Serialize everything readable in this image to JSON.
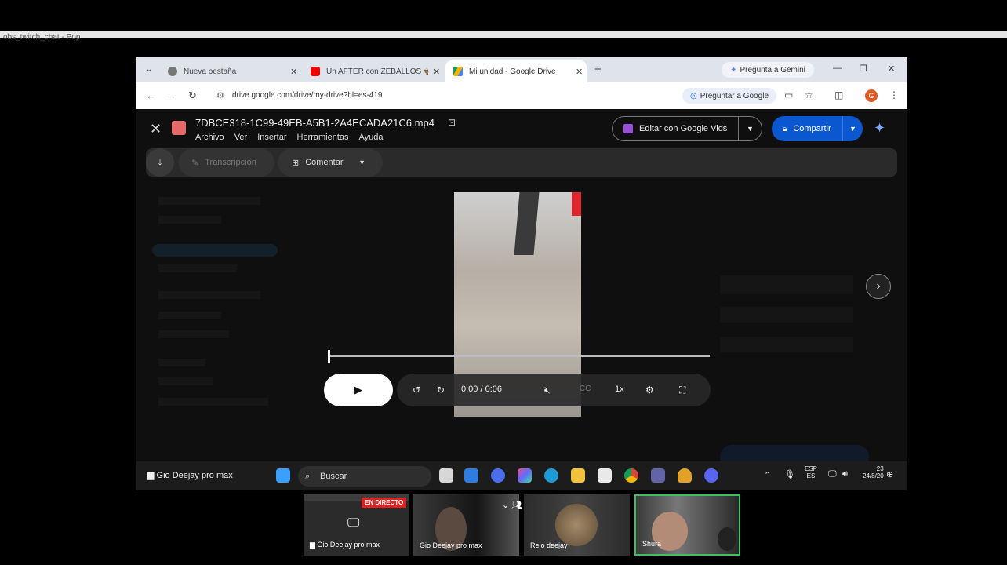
{
  "screen": {
    "top_strip_text": "obs_twitch_chat - Pop"
  },
  "browser": {
    "tabs": [
      {
        "label": "Nueva pestaña",
        "icon": "chrome-icon",
        "close": "✕"
      },
      {
        "label": "Un AFTER con ZEBALLOS 🦋 | L",
        "icon": "youtube-icon",
        "close": "✕"
      },
      {
        "label": "Mi unidad - Google Drive",
        "icon": "drive-icon",
        "close": "✕"
      }
    ],
    "new_tab": "+",
    "gemini_button": "Pregunta a Gemini",
    "url": "drive.google.com/drive/my-drive?hl=es-419",
    "ask_google": "Preguntar a Google",
    "profile_initial": "G"
  },
  "viewer": {
    "file_title": "7DBCE318-1C99-49EB-A5B1-2A4ECADA21C6.mp4",
    "menu": [
      "Archivo",
      "Ver",
      "Insertar",
      "Herramientas",
      "Ayuda"
    ],
    "edit_vids_label": "Editar con Google Vids",
    "share_label": "Compartir",
    "transcription_label": "Transcripción",
    "comment_label": "Comentar",
    "player": {
      "time": "0:00 / 0:06",
      "speed": "1x",
      "progress_fraction": 0.0
    }
  },
  "taskbar": {
    "window_label": "Gio Deejay pro max",
    "search_label": "Buscar",
    "lang_top": "ESP",
    "lang_bottom": "ES",
    "time": "23",
    "date": "24/8/20"
  },
  "cams": [
    {
      "name": "Gio Deejay pro max",
      "live_badge": "EN DIRECTO"
    },
    {
      "name": "Gio Deejay pro max"
    },
    {
      "name": "Relo deejay"
    },
    {
      "name": "Shura"
    }
  ],
  "colors": {
    "accent_share": "#0b57d0",
    "vids_purple": "#9b4fdb",
    "live_red": "#dd2222",
    "cam_active_border": "#3fbf5f"
  }
}
